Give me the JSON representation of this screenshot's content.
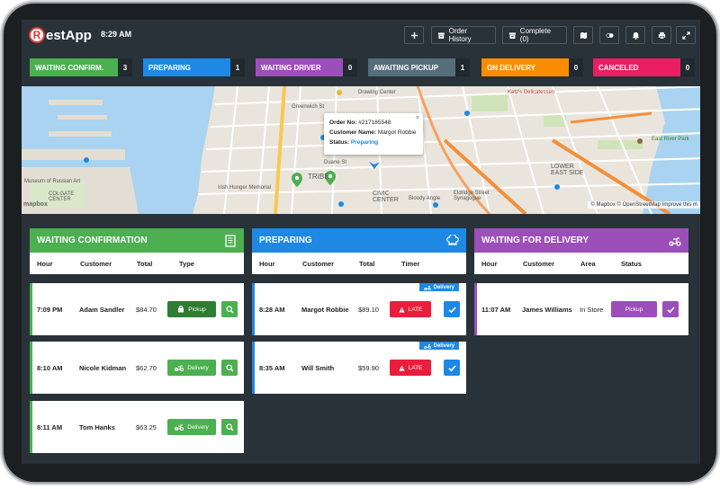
{
  "app": {
    "logo_letter": "R",
    "logo_text": "estApp",
    "time": "8:29 AM"
  },
  "toolbar": {
    "order_history": "Order History",
    "complete": "Complete (0)"
  },
  "status_tabs": [
    {
      "label": "WAITING CONFIRM.",
      "count": "3",
      "color": "#4caf50"
    },
    {
      "label": "PREPARING",
      "count": "1",
      "color": "#1e88e5"
    },
    {
      "label": "WAITING DRIVER",
      "count": "0",
      "color": "#9c4fb8"
    },
    {
      "label": "AWAITING PICKUP",
      "count": "1",
      "color": "#546e7a"
    },
    {
      "label": "ON DELIVERY",
      "count": "0",
      "color": "#fb8c00"
    },
    {
      "label": "CANCELED",
      "count": "0",
      "color": "#e91e63"
    }
  ],
  "map": {
    "popup": {
      "order_label": "Order No:",
      "order_no": "#217185548",
      "customer_label": "Customer Name:",
      "customer": "Margot Robbie",
      "status_label": "Status:",
      "status": "Preparing",
      "close": "×"
    },
    "labels": {
      "drawing_center": "Drawing Center",
      "katz": "Katz's Delicatessen",
      "museum": "Museum of Russian Art",
      "colgate": "COLGATE CENTER",
      "irish": "Irish Hunger Memorial",
      "tribeca": "TRIBE",
      "civic": "CIVIC CENTER",
      "lower_east": "LOWER EAST SIDE",
      "east_river": "East River Park",
      "bloody": "Bloody Angle",
      "eldridge": "Eldridge Street Synagogue",
      "duane": "Duane St",
      "greenwich": "Greenwich St"
    },
    "attribution": "© Mapbox © OpenStreetMap Improve this m",
    "mapbox_logo": "mapbox"
  },
  "panels": {
    "waiting_confirmation": {
      "title": "WAITING CONFIRMATION",
      "columns": [
        "Hour",
        "Customer",
        "Total",
        "Type"
      ],
      "orders": [
        {
          "hour": "7:09 PM",
          "customer": "Adam Sandler",
          "total": "$84.70",
          "type": "Pickup"
        },
        {
          "hour": "8:10 AM",
          "customer": "Nicole Kidman",
          "total": "$62.70",
          "type": "Delivery"
        },
        {
          "hour": "8:11 AM",
          "customer": "Tom Hanks",
          "total": "$63.25",
          "type": "Delivery"
        }
      ]
    },
    "preparing": {
      "title": "PREPARING",
      "columns": [
        "Hour",
        "Customer",
        "Total",
        "Timer"
      ],
      "orders": [
        {
          "hour": "8:28 AM",
          "customer": "Margot Robbie",
          "total": "$89.10",
          "timer": "LATE",
          "ribbon": "Delivery"
        },
        {
          "hour": "8:35 AM",
          "customer": "Will Smith",
          "total": "$59.90",
          "timer": "LATE",
          "ribbon": "Delivery"
        }
      ]
    },
    "waiting_delivery": {
      "title": "WAITING FOR DELIVERY",
      "columns": [
        "Hour",
        "Customer",
        "Area",
        "Status"
      ],
      "orders": [
        {
          "hour": "11:07 AM",
          "customer": "James Williams",
          "area": "In Store",
          "status": "Pickup"
        }
      ]
    }
  },
  "colors": {
    "green": "#4caf50",
    "dark_green": "#2e7d32",
    "blue": "#1e88e5",
    "purple": "#9c4fb8",
    "red": "#e91e3c",
    "dark_bg": "#283238"
  }
}
